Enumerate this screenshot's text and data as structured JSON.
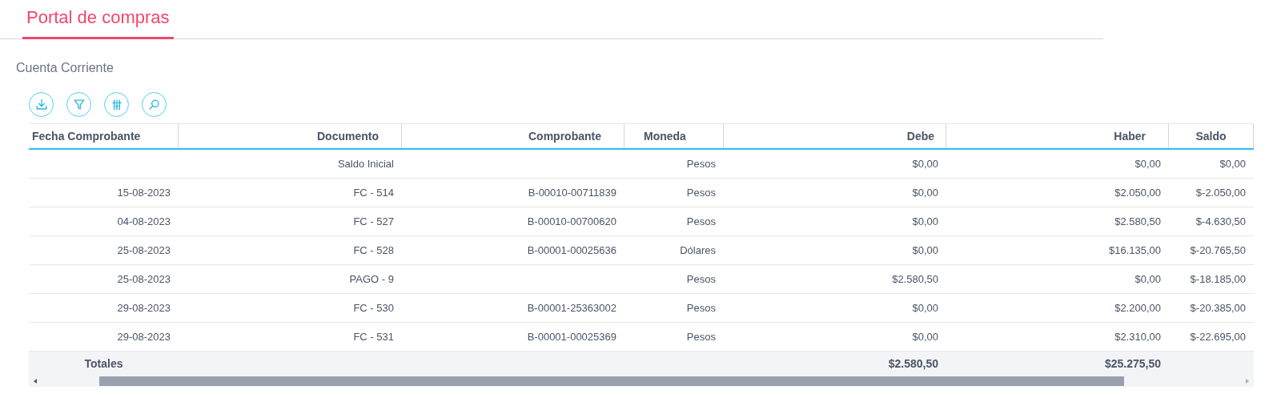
{
  "header": {
    "title": "Portal de compras"
  },
  "section_title": "Cuenta Corriente",
  "toolbar": [
    {
      "kind": "download"
    },
    {
      "kind": "filter"
    },
    {
      "kind": "columns"
    },
    {
      "kind": "search"
    }
  ],
  "table": {
    "columns": [
      "Fecha Comprobante",
      "Documento",
      "Comprobante",
      "Moneda",
      "Debe",
      "Haber",
      "Saldo"
    ],
    "rows": [
      [
        "",
        "Saldo Inicial",
        "",
        "Pesos",
        "$0,00",
        "$0,00",
        "$0,00"
      ],
      [
        "15-08-2023",
        "FC - 514",
        "B-00010-00711839",
        "Pesos",
        "$0,00",
        "$2.050,00",
        "$-2.050,00"
      ],
      [
        "04-08-2023",
        "FC - 527",
        "B-00010-00700620",
        "Pesos",
        "$0,00",
        "$2.580,50",
        "$-4.630,50"
      ],
      [
        "25-08-2023",
        "FC - 528",
        "B-00001-00025636",
        "Dólares",
        "$0,00",
        "$16.135,00",
        "$-20.765,50"
      ],
      [
        "25-08-2023",
        "PAGO - 9",
        "",
        "Pesos",
        "$2.580,50",
        "$0,00",
        "$-18.185,00"
      ],
      [
        "29-08-2023",
        "FC - 530",
        "B-00001-25363002",
        "Pesos",
        "$0,00",
        "$2.200,00",
        "$-20.385,00"
      ],
      [
        "29-08-2023",
        "FC - 531",
        "B-00001-00025369",
        "Pesos",
        "$0,00",
        "$2.310,00",
        "$-22.695,00"
      ]
    ],
    "totals": {
      "label": "Totales",
      "debe": "$2.580,50",
      "haber": "$25.275,50"
    }
  }
}
